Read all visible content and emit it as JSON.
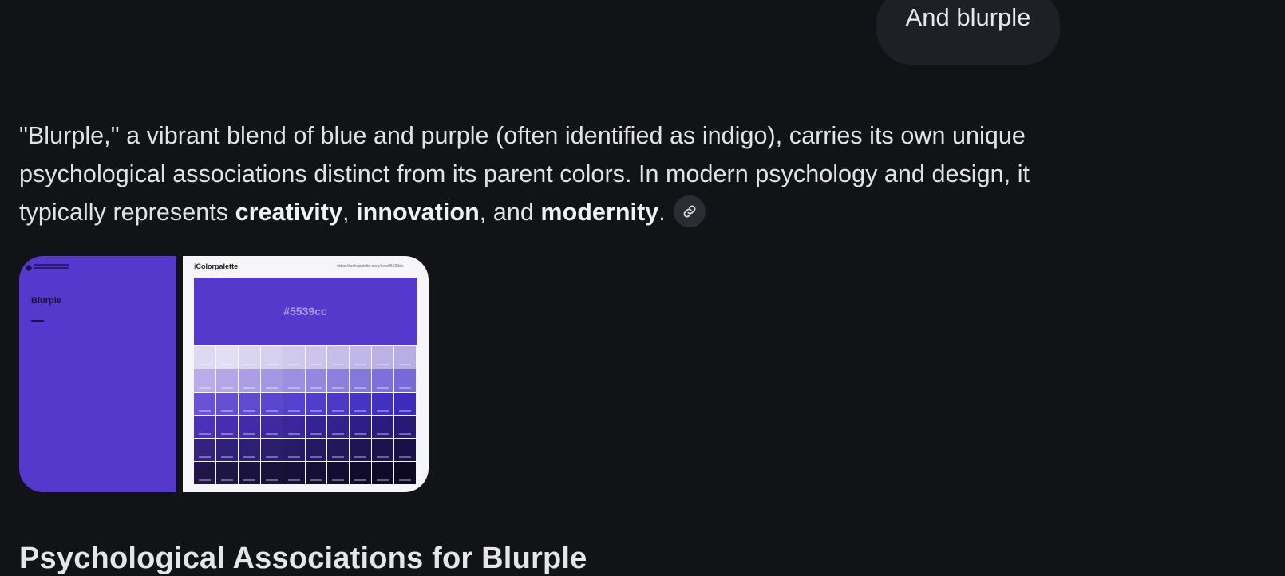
{
  "user_message": {
    "text": "And blurple"
  },
  "answer": {
    "intro": "\"Blurple,\" a vibrant blend of blue and purple (often identified as indigo), carries its own unique psychological associations distinct from its parent colors. In modern psychology and design, it typically represents ",
    "term_1": "creativity",
    "sep_1": ", ",
    "term_2": "innovation",
    "sep_2": ", and ",
    "term_3": "modernity",
    "end": "."
  },
  "images": {
    "left": {
      "title": "Blurple",
      "color": "#5539cc"
    },
    "right": {
      "brand_i": "i",
      "brand_rest": "Colorpalette",
      "url": "https://icolorpalette.com/color/5539cc",
      "hex_label": "#5539cc",
      "grid": [
        [
          "#ddd9f2",
          "#e2dff4",
          "#d9d4f1",
          "#d6d0f0",
          "#d0c9ee",
          "#ccc4ed",
          "#c5bdeb",
          "#bfb6e9",
          "#bbb1e8",
          "#b7ade7"
        ],
        [
          "#b8acea",
          "#b2a5e8",
          "#ab9ee6",
          "#a497e4",
          "#9c8ee2",
          "#9587e0",
          "#8d7fde",
          "#8677dc",
          "#7e70da",
          "#7868d8"
        ],
        [
          "#6a52d6",
          "#6550d4",
          "#5f4bd2",
          "#5a46d0",
          "#5541ce",
          "#503dcc",
          "#4b38c8",
          "#4634c4",
          "#4230c0",
          "#3d2cbc"
        ],
        [
          "#4a31b6",
          "#462eaf",
          "#422ba8",
          "#3e29a1",
          "#3a269a",
          "#362393",
          "#33218c",
          "#2f1e85",
          "#2b1b7e",
          "#281977"
        ],
        [
          "#33237e",
          "#302178",
          "#2d1f72",
          "#2a1d6c",
          "#271b66",
          "#241960",
          "#21175a",
          "#1e1554",
          "#1b134e",
          "#181148"
        ],
        [
          "#1f1647",
          "#1d1543",
          "#1b133f",
          "#19123b",
          "#171037",
          "#150f33",
          "#130d2f",
          "#110c2b",
          "#0f0a27",
          "#0d0923"
        ]
      ]
    }
  },
  "heading": "Psychological Associations for Blurple"
}
